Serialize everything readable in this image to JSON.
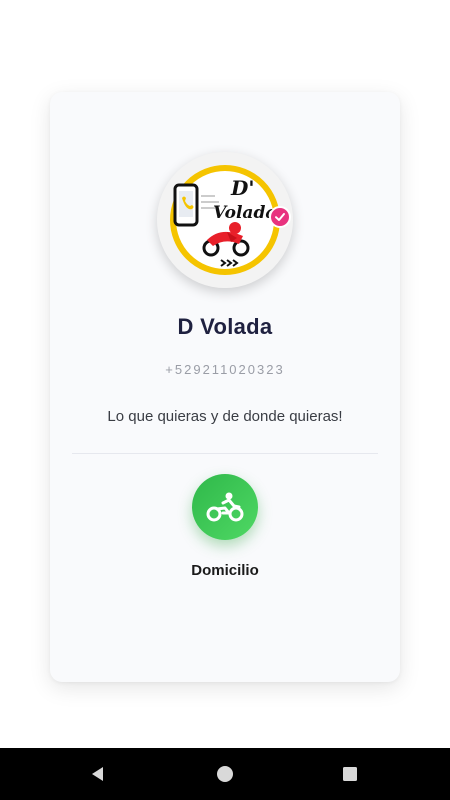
{
  "profile": {
    "name": "D Volada",
    "phone": "+529211020323",
    "description": "Lo que quieras y de donde quieras!",
    "logo_text": "D' Volada",
    "verified_icon": "check-badge-icon"
  },
  "services": [
    {
      "label": "Domicilio",
      "icon": "motorcycle-icon"
    }
  ],
  "colors": {
    "accent_green": "#3cc556",
    "title": "#1f2140",
    "badge_pink": "#e8337f",
    "logo_yellow": "#f5c400"
  },
  "navbar": {
    "back_icon": "back-triangle-icon",
    "home_icon": "home-circle-icon",
    "recents_icon": "recents-square-icon"
  }
}
